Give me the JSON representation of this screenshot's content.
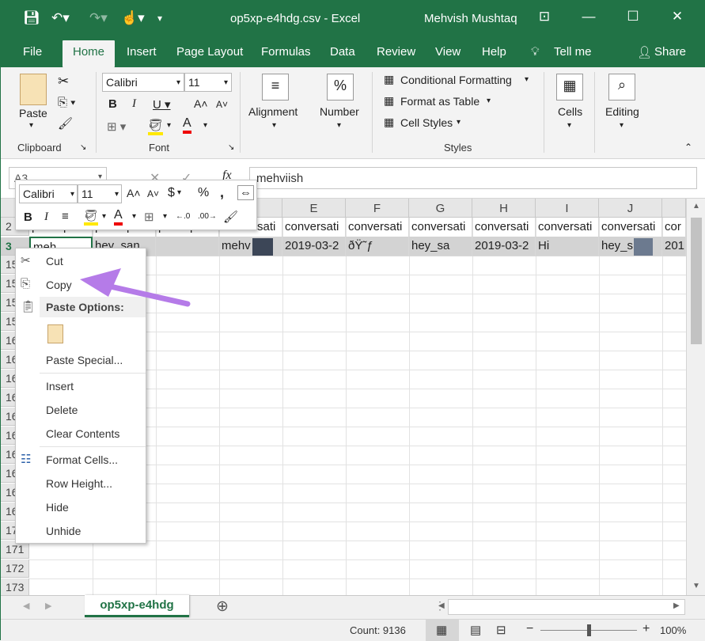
{
  "title_bar": {
    "title": "op5xp-e4hdg.csv  -  Excel",
    "user": "Mehvish Mushtaq"
  },
  "tabs": [
    "File",
    "Home",
    "Insert",
    "Page Layout",
    "Formulas",
    "Data",
    "Review",
    "View",
    "Help",
    "Tell me",
    "Share"
  ],
  "ribbon": {
    "clipboard_label": "Clipboard",
    "paste": "Paste",
    "font_label": "Font",
    "font_name": "Calibri",
    "font_size": "11",
    "alignment": "Alignment",
    "number": "Number",
    "conditional": "Conditional Formatting",
    "format_table": "Format as Table",
    "cell_styles": "Cell Styles",
    "styles_label": "Styles",
    "cells": "Cells",
    "editing": "Editing"
  },
  "formula_bar": {
    "name_box": "A3",
    "value": "mehviish"
  },
  "mini_toolbar": {
    "font": "Calibri",
    "size": "11"
  },
  "columns": [
    "E",
    "F",
    "G",
    "H",
    "I",
    "J"
  ],
  "row_headers": [
    "2",
    "3",
    "15",
    "15",
    "15",
    "15",
    "16",
    "16",
    "16",
    "16",
    "16",
    "16",
    "16",
    "16",
    "16",
    "16",
    "17",
    "171",
    "172",
    "173"
  ],
  "row2": [
    "participan",
    "participan",
    "participan",
    "conversati",
    "conversati",
    "conversati",
    "conversati",
    "conversati",
    "conversati",
    "conversati",
    "conversati",
    "cor"
  ],
  "row3": [
    "meh",
    "hey_san",
    "",
    "mehv",
    "2019-03-2",
    "ðŸ˜ƒ",
    "hey_sa",
    "2019-03-2",
    "Hi",
    "hey_s",
    "201"
  ],
  "context_menu": {
    "cut": "Cut",
    "copy": "Copy",
    "paste_options": "Paste Options:",
    "paste_special": "Paste Special...",
    "insert": "Insert",
    "delete": "Delete",
    "clear": "Clear Contents",
    "format_cells": "Format Cells...",
    "row_height": "Row Height...",
    "hide": "Hide",
    "unhide": "Unhide"
  },
  "sheet_tab": "op5xp-e4hdg",
  "status": {
    "count": "Count: 9136",
    "zoom": "100%"
  },
  "colors": {
    "accent": "#217346",
    "arrow": "#b57be8"
  }
}
